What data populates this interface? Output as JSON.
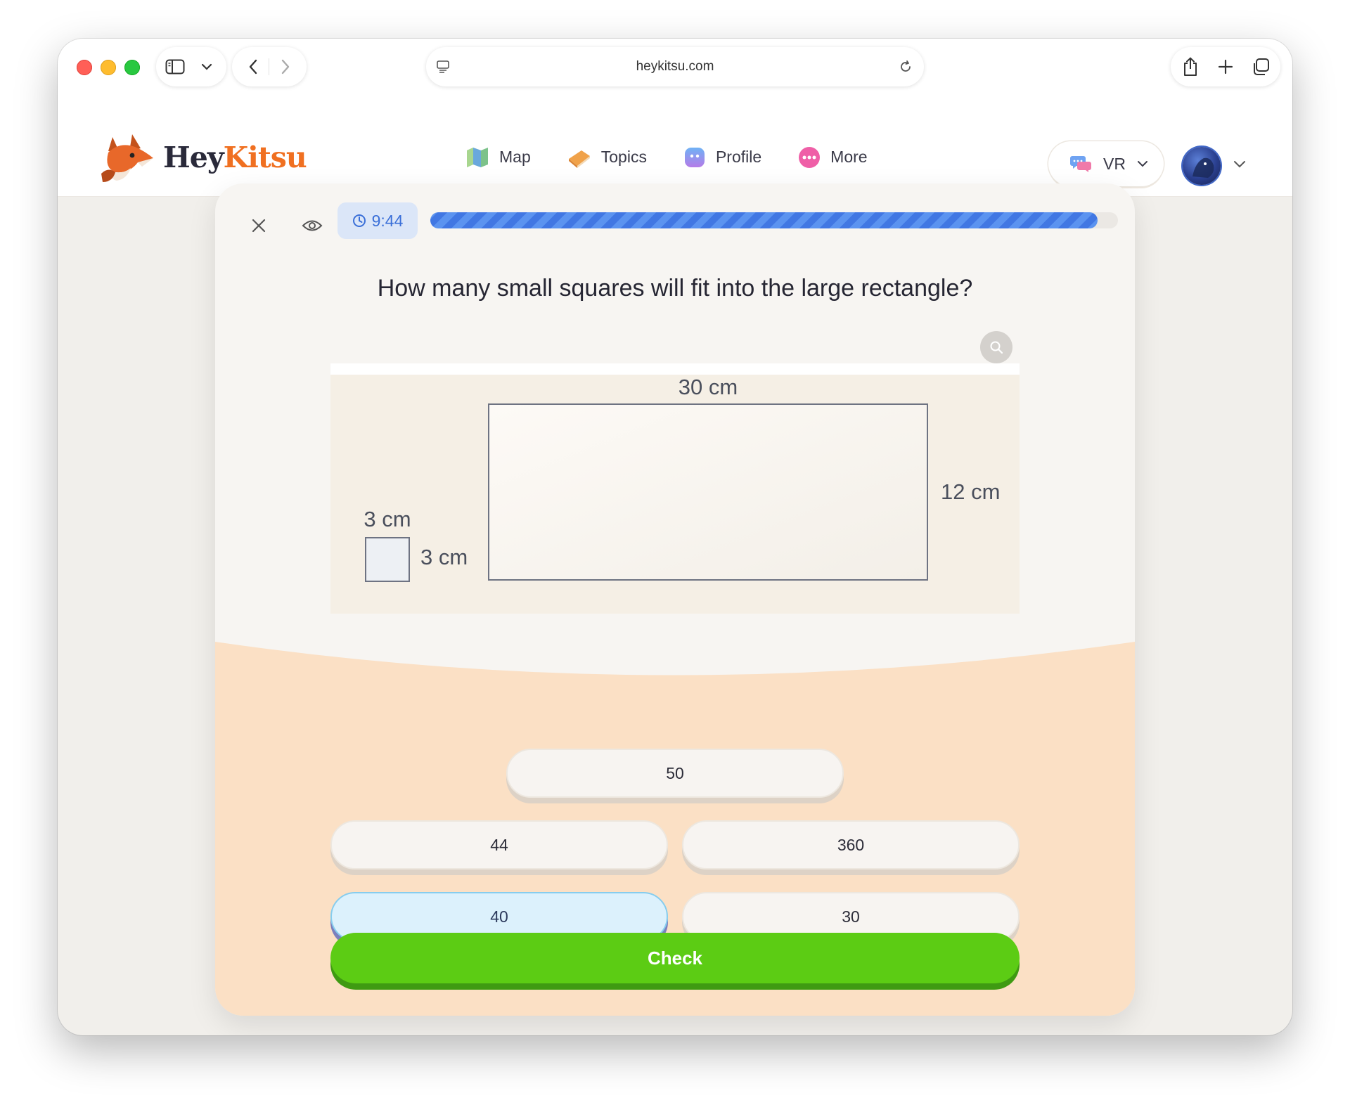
{
  "browser": {
    "url": "heykitsu.com",
    "icons": [
      "sidebar-toggle-icon",
      "chevron-down-icon",
      "back-icon",
      "forward-icon",
      "page-menu-icon",
      "reload-icon",
      "share-icon",
      "new-tab-icon",
      "tabs-overview-icon"
    ]
  },
  "site": {
    "logo_hey": "Hey",
    "logo_kitsu": "Kitsu",
    "nav": [
      {
        "label": "Map",
        "icon": "map-icon"
      },
      {
        "label": "Topics",
        "icon": "book-icon"
      },
      {
        "label": "Profile",
        "icon": "profile-icon"
      },
      {
        "label": "More",
        "icon": "more-icon"
      }
    ],
    "language": {
      "label": "VR",
      "icon": "chat-bubbles-icon"
    },
    "brand_color": "#f07021"
  },
  "quiz": {
    "timer": "9:44",
    "progress": 0.97,
    "question": "How many small squares will fit into the large rectangle?",
    "figure": {
      "large_width_label": "30 cm",
      "large_height_label": "12 cm",
      "small_width_label": "3 cm",
      "small_height_label": "3 cm"
    },
    "answers": [
      {
        "label": "50",
        "selected": false
      },
      {
        "label": "44",
        "selected": false
      },
      {
        "label": "360",
        "selected": false
      },
      {
        "label": "40",
        "selected": true
      },
      {
        "label": "30",
        "selected": false
      }
    ],
    "check_label": "Check",
    "check_color": "#5ccc14",
    "selected_color": "#dcf1fc"
  }
}
